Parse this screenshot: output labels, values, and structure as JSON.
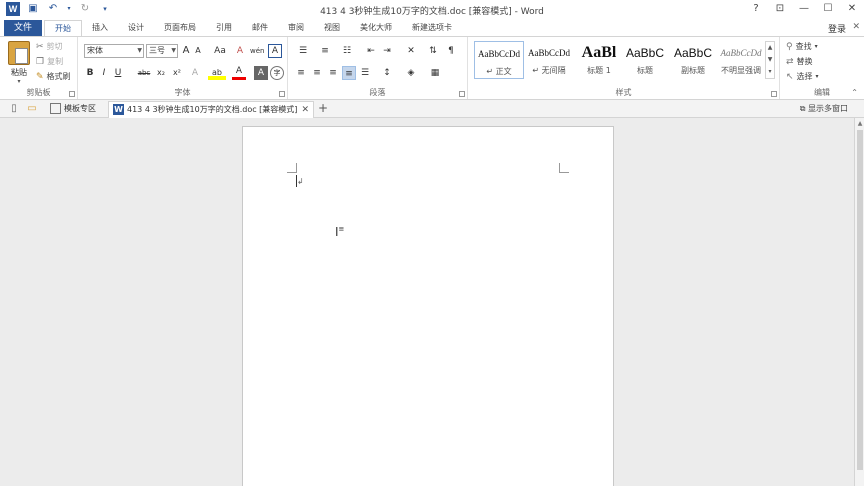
{
  "window": {
    "title": "413 4 3秒钟生成10万字的文档.doc [兼容模式] - Word",
    "help": "?",
    "login": "登录"
  },
  "ribbon_tabs": {
    "file": "文件",
    "items": [
      "开始",
      "插入",
      "设计",
      "页面布局",
      "引用",
      "邮件",
      "审阅",
      "视图",
      "美化大师",
      "新建选项卡"
    ],
    "active_index": 0
  },
  "clipboard": {
    "paste": "粘贴",
    "cut": "剪切",
    "copy": "复制",
    "format_painter": "格式刷",
    "label": "剪贴板"
  },
  "font": {
    "name": "宋体",
    "size": "三号",
    "label": "字体",
    "grow": "A",
    "shrink": "A",
    "case": "Aa",
    "clear": "A",
    "wen": "wén",
    "border_char": "A",
    "bold": "B",
    "italic": "I",
    "underline": "U",
    "strike": "abc",
    "sub": "x₂",
    "sup": "x²",
    "effects": "A",
    "highlight": "ab",
    "color": "A",
    "shade": "A",
    "circle": "字"
  },
  "paragraph": {
    "label": "段落"
  },
  "styles": {
    "label": "样式",
    "items": [
      {
        "preview": "AaBbCcDd",
        "name": "↵ 正文"
      },
      {
        "preview": "AaBbCcDd",
        "name": "↵ 无间隔"
      },
      {
        "preview": "AaBl",
        "name": "标题 1"
      },
      {
        "preview": "AaBbC",
        "name": "标题"
      },
      {
        "preview": "AaBbC",
        "name": "副标题"
      },
      {
        "preview": "AaBbCcDd",
        "name": "不明显强调"
      }
    ]
  },
  "editing": {
    "label": "编辑",
    "find": "查找",
    "replace": "替换",
    "select": "选择"
  },
  "doc_tabs": {
    "home": "模板专区",
    "doc": "413 4 3秒钟生成10万字的文档.doc [兼容模式]",
    "close": "✕",
    "add": "+",
    "show_all": "显示多窗口"
  }
}
